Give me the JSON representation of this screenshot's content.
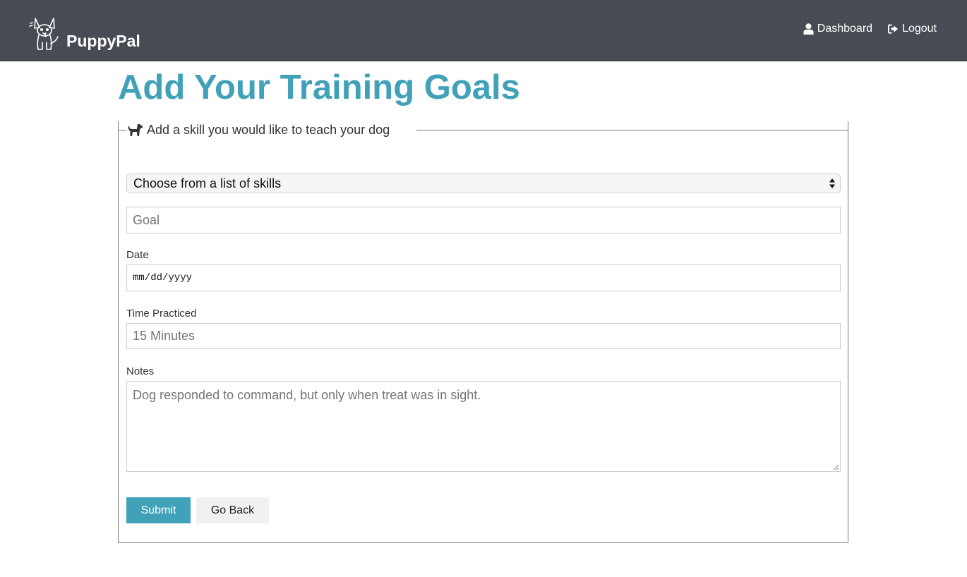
{
  "navbar": {
    "brand": "PuppyPal",
    "links": [
      {
        "label": "Dashboard",
        "icon": "user-icon"
      },
      {
        "label": "Logout",
        "icon": "sign-out-icon"
      }
    ]
  },
  "page": {
    "title": "Add Your Training Goals"
  },
  "form": {
    "legend": "Add a skill you would like to teach your dog",
    "legend_icon": "dog-icon",
    "skill_select": {
      "selected": "Choose from a list of skills"
    },
    "goal": {
      "placeholder": "Goal"
    },
    "date": {
      "label": "Date",
      "placeholder": "mm/dd/yyyy"
    },
    "time": {
      "label": "Time Practiced",
      "placeholder": "15 Minutes"
    },
    "notes": {
      "label": "Notes",
      "placeholder": "Dog responded to command, but only when treat was in sight."
    },
    "buttons": {
      "submit": "Submit",
      "back": "Go Back"
    }
  },
  "colors": {
    "navbar_bg": "#474c54",
    "accent": "#41a1b8",
    "secondary_button_bg": "#f1f1f1"
  }
}
